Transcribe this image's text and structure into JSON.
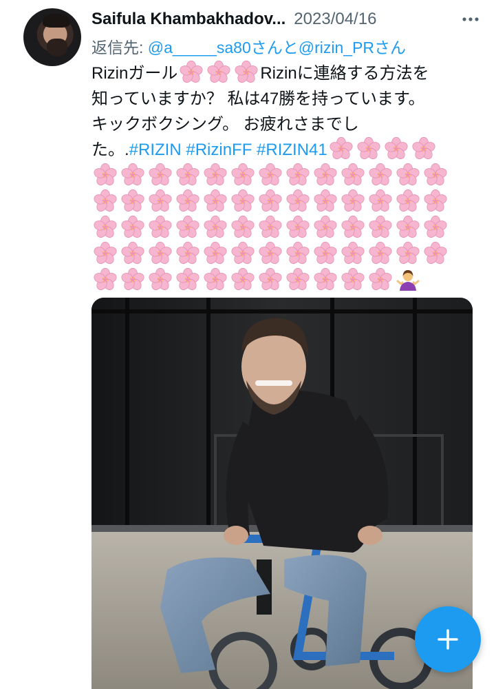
{
  "tweet": {
    "author_name": "Saifula Khambakhadov...",
    "date": "2023/04/16",
    "reply_prefix": "返信先:",
    "reply_mentions": "@a_____sa80さんと@rizin_PRさん",
    "text_line1_a": "Rizinガール",
    "text_line1_b": "Rizinに連絡する方法を",
    "text_line2": "知っていますか？ 私は47勝を持っています。",
    "text_line3": "キックボクシング。 お疲れさまでし",
    "text_line4_a": "た。.",
    "hashtags": [
      "#RIZIN",
      "#RizinFF",
      "#RIZIN41"
    ],
    "emoji_rows": [
      13,
      13,
      13,
      13,
      11
    ],
    "emoji_name": "cherry-blossom",
    "trailing_emoji": "person-shrugging"
  },
  "colors": {
    "link": "#1d9bf0",
    "secondary_text": "#536471",
    "fab": "#1d9bf0",
    "blossom": "#f7b6cf"
  },
  "fab": {
    "icon": "plus-icon"
  }
}
